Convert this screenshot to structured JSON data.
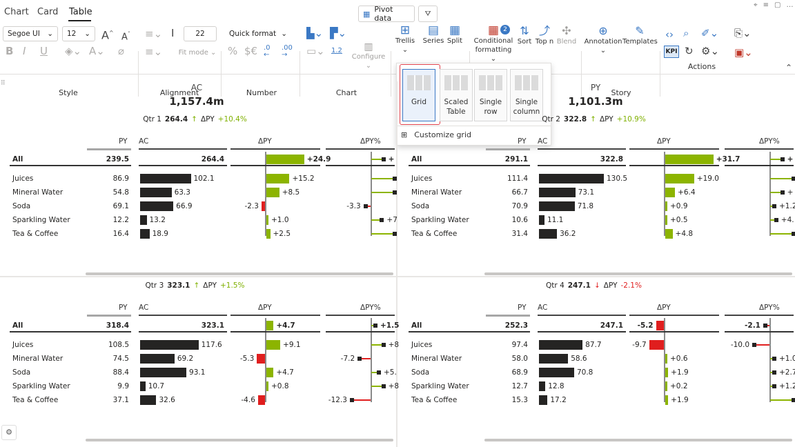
{
  "tabs": [
    "Chart",
    "Card",
    "Table"
  ],
  "pivot_label": "Pivot data",
  "ribbon": {
    "font_name": "Segoe UI",
    "font_size": "12",
    "indent_value": "22",
    "quick_format": "Quick format",
    "fit_mode": "Fit mode",
    "configure": "Configure",
    "trellis": "Trellis",
    "series": "Series",
    "split": "Split",
    "cond_format_1": "Conditional",
    "cond_format_2": "formatting",
    "cond_badge": "2",
    "sort": "Sort",
    "topn": "Top n",
    "blend": "Blend",
    "annotation": "Annotation",
    "templates": "Templates",
    "kpi": "KPI",
    "num_12": "1.2",
    "groups": [
      "Style",
      "Alignment",
      "Number",
      "Chart",
      "Story",
      "Actions"
    ]
  },
  "trellis_popup": {
    "options": [
      {
        "l1": "Grid",
        "l2": ""
      },
      {
        "l1": "Scaled",
        "l2": "Table"
      },
      {
        "l1": "Single",
        "l2": "row"
      },
      {
        "l1": "Single",
        "l2": "column"
      }
    ],
    "customize": "Customize grid"
  },
  "summary": {
    "ac_label": "AC",
    "ac_value": "1,157.4m",
    "py_label": "PY",
    "py_value": "1,101.3m"
  },
  "panels": [
    {
      "quarter": "Qtr 1",
      "total": "264.4",
      "arrow": "↑",
      "dpy_label": "ΔPY",
      "dpy": "+10.4%",
      "dir": "up",
      "headers": {
        "py": "PY",
        "ac": "AC",
        "dpy": "ΔPY",
        "dpyp": "ΔPY%"
      },
      "rows": [
        {
          "name": "All",
          "py": "239.5",
          "ac": "264.4",
          "d": "+24.9",
          "dp": "+",
          "bold": true
        },
        {
          "name": "Juices",
          "py": "86.9",
          "ac": "102.1",
          "d": "+15.2",
          "dp": ""
        },
        {
          "name": "Mineral Water",
          "py": "54.8",
          "ac": "63.3",
          "d": "+8.5",
          "dp": ""
        },
        {
          "name": "Soda",
          "py": "69.1",
          "ac": "66.9",
          "d": "-2.3",
          "dp": "-3.3"
        },
        {
          "name": "Sparkling Water",
          "py": "12.2",
          "ac": "13.2",
          "d": "+1.0",
          "dp": "+7"
        },
        {
          "name": "Tea & Coffee",
          "py": "16.4",
          "ac": "18.9",
          "d": "+2.5",
          "dp": ""
        }
      ]
    },
    {
      "quarter": "Qtr 2",
      "total": "322.8",
      "arrow": "↑",
      "dpy_label": "ΔPY",
      "dpy": "+10.9%",
      "dir": "up",
      "headers": {
        "py": "PY",
        "ac": "AC",
        "dpy": "ΔPY",
        "dpyp": "ΔPY%"
      },
      "rows": [
        {
          "name": "All",
          "py": "291.1",
          "ac": "322.8",
          "d": "+31.7",
          "dp": "+",
          "bold": true
        },
        {
          "name": "Juices",
          "py": "111.4",
          "ac": "130.5",
          "d": "+19.0",
          "dp": ""
        },
        {
          "name": "Mineral Water",
          "py": "66.7",
          "ac": "73.1",
          "d": "+6.4",
          "dp": "+"
        },
        {
          "name": "Soda",
          "py": "70.9",
          "ac": "71.8",
          "d": "+0.9",
          "dp": "+1.2"
        },
        {
          "name": "Sparkling Water",
          "py": "10.6",
          "ac": "11.1",
          "d": "+0.5",
          "dp": "+4."
        },
        {
          "name": "Tea & Coffee",
          "py": "31.4",
          "ac": "36.2",
          "d": "+4.8",
          "dp": ""
        }
      ]
    },
    {
      "quarter": "Qtr 3",
      "total": "323.1",
      "arrow": "↑",
      "dpy_label": "ΔPY",
      "dpy": "+1.5%",
      "dir": "up",
      "headers": {
        "py": "PY",
        "ac": "AC",
        "dpy": "ΔPY",
        "dpyp": "ΔPY%"
      },
      "rows": [
        {
          "name": "All",
          "py": "318.4",
          "ac": "323.1",
          "d": "+4.7",
          "dp": "+1.5",
          "bold": true
        },
        {
          "name": "Juices",
          "py": "108.5",
          "ac": "117.6",
          "d": "+9.1",
          "dp": "+8"
        },
        {
          "name": "Mineral Water",
          "py": "74.5",
          "ac": "69.2",
          "d": "-5.3",
          "dp": "-7.2"
        },
        {
          "name": "Soda",
          "py": "88.4",
          "ac": "93.1",
          "d": "+4.7",
          "dp": "+5."
        },
        {
          "name": "Sparkling Water",
          "py": "9.9",
          "ac": "10.7",
          "d": "+0.8",
          "dp": "+8"
        },
        {
          "name": "Tea & Coffee",
          "py": "37.1",
          "ac": "32.6",
          "d": "-4.6",
          "dp": "-12.3"
        }
      ]
    },
    {
      "quarter": "Qtr 4",
      "total": "247.1",
      "arrow": "↓",
      "dpy_label": "ΔPY",
      "dpy": "-2.1%",
      "dir": "down",
      "headers": {
        "py": "PY",
        "ac": "AC",
        "dpy": "ΔPY",
        "dpyp": "ΔPY%"
      },
      "rows": [
        {
          "name": "All",
          "py": "252.3",
          "ac": "247.1",
          "d": "-5.2",
          "dp": "-2.1",
          "bold": true
        },
        {
          "name": "Juices",
          "py": "97.4",
          "ac": "87.7",
          "d": "-9.7",
          "dp": "-10.0"
        },
        {
          "name": "Mineral Water",
          "py": "58.0",
          "ac": "58.6",
          "d": "+0.6",
          "dp": "+1.0"
        },
        {
          "name": "Soda",
          "py": "68.9",
          "ac": "70.8",
          "d": "+1.9",
          "dp": "+2.7"
        },
        {
          "name": "Sparkling Water",
          "py": "12.7",
          "ac": "12.8",
          "d": "+0.2",
          "dp": "+1.2"
        },
        {
          "name": "Tea & Coffee",
          "py": "15.3",
          "ac": "17.2",
          "d": "+1.9",
          "dp": ""
        }
      ]
    }
  ],
  "colors": {
    "positive": "#8cb400",
    "negative": "#e01e1e",
    "bar": "#252423",
    "accent": "#3a78c4"
  }
}
